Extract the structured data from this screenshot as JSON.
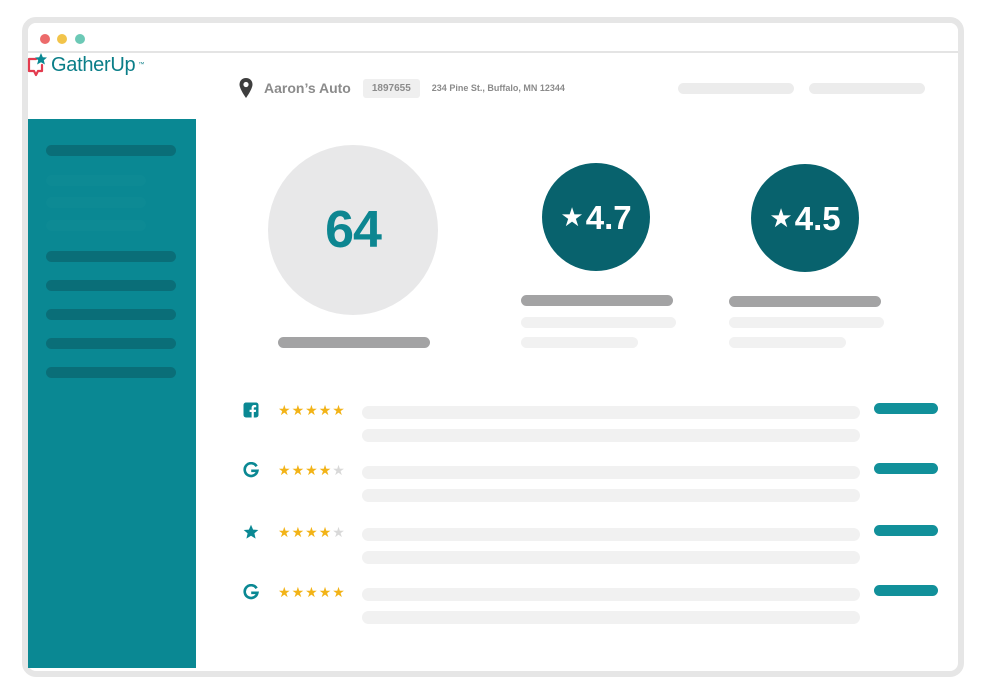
{
  "app": {
    "logo_text": "GatherUp",
    "logo_tm": "™"
  },
  "colors": {
    "teal": "#0a8893",
    "teal_dark": "#08626d",
    "star_gold": "#f2b317",
    "window_dots": [
      "#ec6b6b",
      "#f2c44a",
      "#6cc9b6"
    ]
  },
  "header": {
    "location_icon": "map-pin-icon",
    "business_name": "Aaron’s Auto",
    "business_id": "1897655",
    "address": "234 Pine St., Buffalo, MN 12344"
  },
  "metrics": {
    "score": "64",
    "ratings": [
      {
        "star": "★",
        "value": "4.7"
      },
      {
        "star": "★",
        "value": "4.5"
      }
    ]
  },
  "reviews": [
    {
      "source_icon": "facebook-icon",
      "rating": 5
    },
    {
      "source_icon": "google-icon",
      "rating": 4
    },
    {
      "source_icon": "star-icon",
      "rating": 4
    },
    {
      "source_icon": "google-icon",
      "rating": 5
    }
  ]
}
